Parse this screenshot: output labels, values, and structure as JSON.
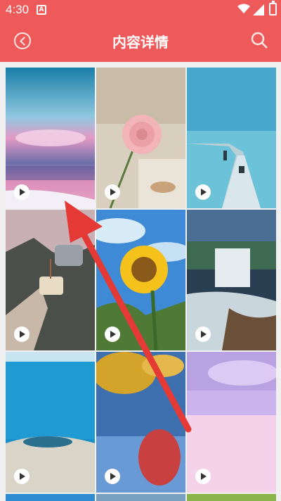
{
  "status_bar": {
    "time": "4:30",
    "notification_badge": "A"
  },
  "navbar": {
    "title": "内容详情"
  },
  "icons": {
    "back": "back-icon",
    "search": "search-icon",
    "play": "play-icon"
  },
  "colors": {
    "header": "#ee5a5a",
    "arrow": "#e53935"
  },
  "grid": {
    "items": [
      {
        "name": "pink-sunset-ocean"
      },
      {
        "name": "pink-flower"
      },
      {
        "name": "pier-sea"
      },
      {
        "name": "tea-cup-pour"
      },
      {
        "name": "sunflower"
      },
      {
        "name": "waterfall"
      },
      {
        "name": "blue-lake"
      },
      {
        "name": "yellow-red-leaves"
      },
      {
        "name": "pink-sea"
      }
    ]
  }
}
